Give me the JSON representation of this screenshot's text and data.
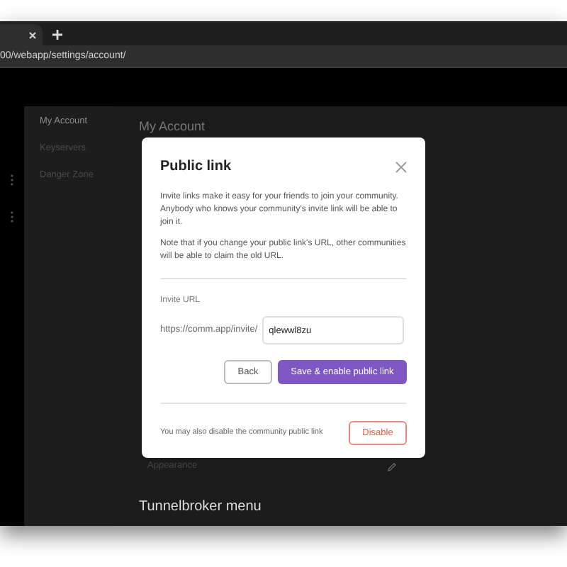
{
  "browser": {
    "address": "00/webapp/settings/account/"
  },
  "sidebar": {
    "items": [
      {
        "label": "My Account",
        "selected": true
      },
      {
        "label": "Keyservers",
        "selected": false
      },
      {
        "label": "Danger Zone",
        "selected": false
      }
    ]
  },
  "page": {
    "title": "My Account",
    "rows": [
      {
        "label": "Appearance"
      }
    ],
    "section": "Tunnelbroker menu"
  },
  "modal": {
    "title": "Public link",
    "paragraphs": [
      "Invite links make it easy for your friends to join your community. Anybody who knows your community's invite link will be able to join it.",
      "Note that if you change your public link's URL, other communities will be able to claim the old URL."
    ],
    "field_label": "Invite URL",
    "prefix": "https://comm.app/invite/",
    "value": "qlewwl8zu",
    "buttons": [
      {
        "label": "Back",
        "kind": "secondary"
      },
      {
        "label": "Save & enable public link",
        "kind": "primary"
      }
    ],
    "footer": {
      "text": "You may also disable the community public link",
      "button": "Disable"
    }
  }
}
